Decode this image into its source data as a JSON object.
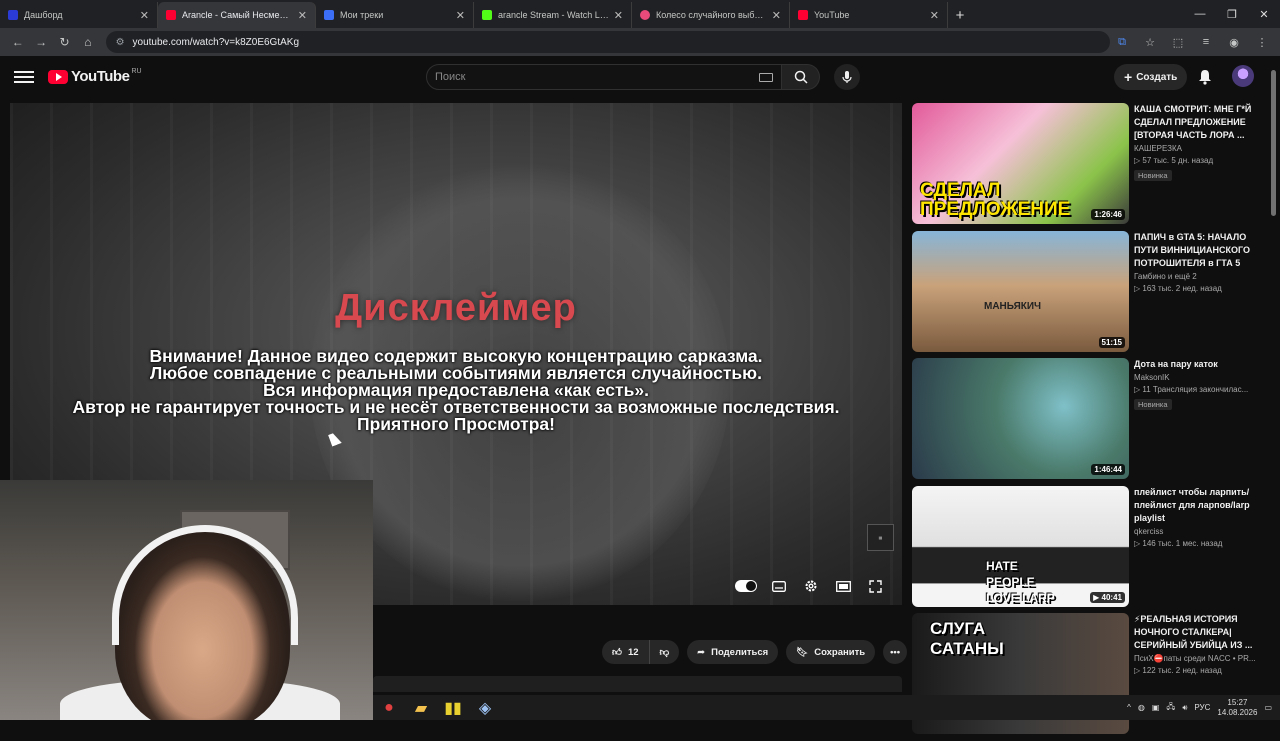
{
  "browser": {
    "tabs": [
      {
        "title": "Дашборд",
        "favicon_color": "#2a3bd6",
        "active": false
      },
      {
        "title": "Arancle - Самый Несмешной",
        "favicon_color": "#ff0033",
        "active": true
      },
      {
        "title": "Мои треки",
        "favicon_color": "#3b6ef5",
        "active": false
      },
      {
        "title": "arancle Stream - Watch Live on",
        "favicon_color": "#53fc18",
        "active": false
      },
      {
        "title": "Колесо случайного выбора -",
        "favicon_color": "#e84a7a",
        "active": false
      },
      {
        "title": "YouTube",
        "favicon_color": "#ff0033",
        "active": false
      }
    ],
    "url": "youtube.com/watch?v=k8Z0E6GtAKg"
  },
  "youtube": {
    "logo_text": "YouTube",
    "region": "RU",
    "search_placeholder": "Поиск",
    "create_label": "Создать"
  },
  "video": {
    "disclaimer_title": "Дисклеймер",
    "disclaimer_lines": [
      "Внимание! Данное видео содержит высокую концентрацию сарказма.",
      "Любое совпадение с реальными событиями является случайностью.",
      "Вся информация предоставлена «как есть».",
      "Автор не гарантирует точность и не несёт ответственности за возможные последствия.",
      "Приятного Просмотра!"
    ]
  },
  "actions": {
    "likes": "12",
    "share_label": "Поделиться",
    "save_label": "Сохранить"
  },
  "recommendations": [
    {
      "title": "КАША СМОТРИТ: МНЕ Г*Й СДЕЛАЛ ПРЕДЛОЖЕНИЕ [ВТОРАЯ ЧАСТЬ ЛОРА ...",
      "channel": "КАШЕРЕЗКА",
      "stats": "▷ 57 тыс.  5 дн. назад",
      "badge": "Новинка",
      "duration": "1:26:46",
      "thumb_text": "СДЕЛАЛ ПРЕДЛОЖЕНИЕ",
      "thumb_color": "#e25a9a"
    },
    {
      "title": "ПАПИЧ в GTA 5: НАЧАЛО ПУТИ ВИННИЦИАНСКОГО ПОТРОШИТЕЛЯ в ГТА 5",
      "channel": "Гамбино и ещё 2",
      "stats": "▷ 163 тыс.  2 нед. назад",
      "badge": "",
      "duration": "51:15",
      "thumb_text": "МАНЬЯКИЧ",
      "thumb_color": "#b77a4a"
    },
    {
      "title": "Дота на пару каток",
      "channel": "MaksonIK",
      "stats": "▷ 11  Трансляция закончилас...",
      "badge": "Новинка",
      "duration": "1:46:44",
      "thumb_text": "",
      "thumb_color": "#3f6a78"
    },
    {
      "title": "плейлист чтобы ларпить/ плейлист для ларпов/larp playlist",
      "channel": "qkerciss",
      "stats": "▷ 146 тыс.  1 мес. назад",
      "badge": "",
      "duration": "▶ 40:41",
      "thumb_text": "HATE PEOPLE LOVE LARP",
      "thumb_color": "#f0f0f0"
    },
    {
      "title": "⚡РЕАЛЬНАЯ ИСТОРИЯ НОЧНОГО СТАЛКЕРА| СЕРИЙНЫЙ УБИЙЦА ИЗ ...",
      "channel": "ПсиХ⛔паты среди NACC • PR...",
      "stats": "▷ 122 тыс.  2 нед. назад",
      "badge": "",
      "duration": "",
      "thumb_text": "СЛУГА САТАНЫ",
      "thumb_color": "#2a2a2a"
    }
  ],
  "taskbar": {
    "lang": "РУС",
    "time": "15:27",
    "date": "14.08.2026"
  },
  "colors": {
    "accent": "#ff0033",
    "disclaimer_title": "#d8484f",
    "background": "#0f0f0f"
  }
}
